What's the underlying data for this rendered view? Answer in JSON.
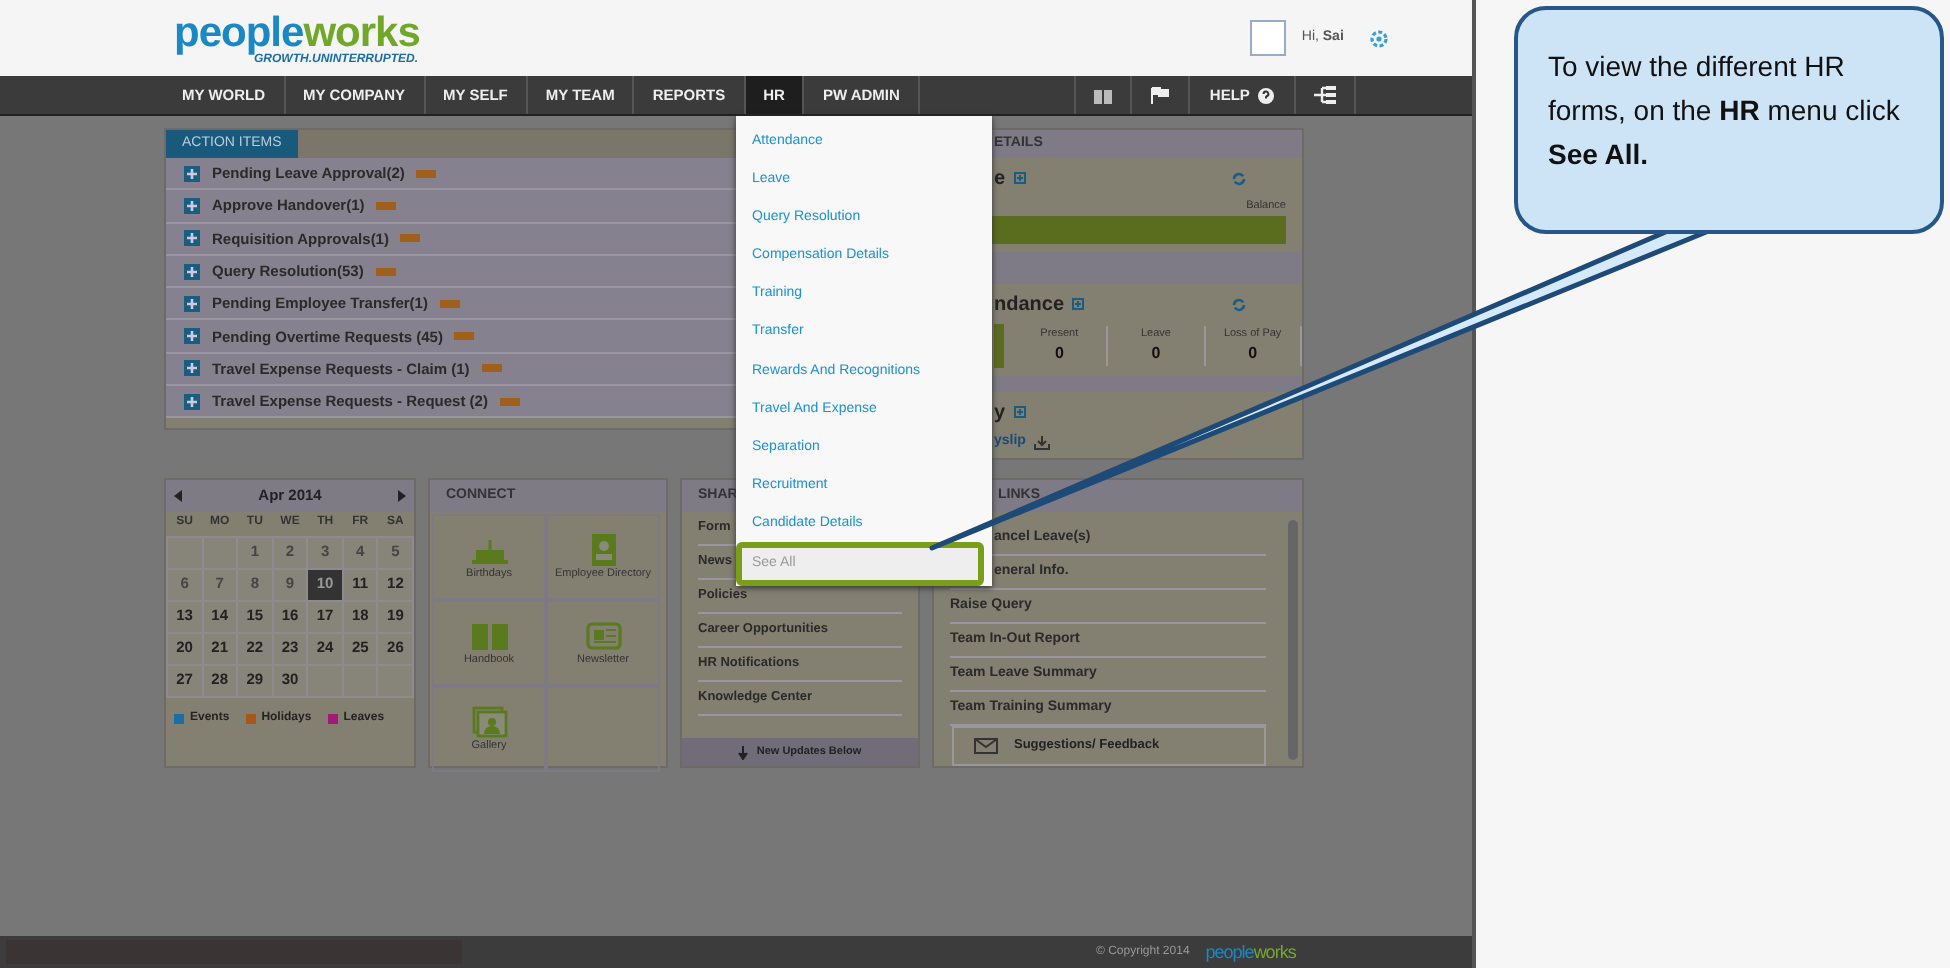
{
  "header": {
    "logo_parts": [
      "people",
      "works"
    ],
    "tagline": "GROWTH.UNINTERRUPTED.",
    "greeting": "Hi,",
    "user": "Sai"
  },
  "nav": [
    {
      "label": "MY WORLD",
      "selected": false
    },
    {
      "label": "MY COMPANY",
      "selected": false
    },
    {
      "label": "MY SELF",
      "selected": false
    },
    {
      "label": "MY TEAM",
      "selected": false
    },
    {
      "label": "REPORTS",
      "selected": false
    },
    {
      "label": "HR",
      "selected": true
    },
    {
      "label": "PW ADMIN",
      "selected": false
    }
  ],
  "help": "HELP",
  "hr_menu": [
    {
      "label": "Attendance",
      "selected": false
    },
    {
      "label": "Leave",
      "selected": false
    },
    {
      "label": "Query Resolution",
      "selected": false
    },
    {
      "label": "Compensation Details",
      "selected": false
    },
    {
      "label": "Training",
      "selected": false
    },
    {
      "label": "Transfer",
      "selected": false
    },
    {
      "label": "Rewards And Recognitions",
      "selected": false
    },
    {
      "label": "Travel And Expense",
      "selected": false
    },
    {
      "label": "Separation",
      "selected": false
    },
    {
      "label": "Recruitment",
      "selected": false
    },
    {
      "label": "Candidate Details",
      "selected": false
    },
    {
      "label": "See All",
      "selected": true
    }
  ],
  "action_items": {
    "title": "ACTION ITEMS",
    "items": [
      "Pending Leave Approval(2)",
      "Approve Handover(1)",
      "Requisition Approvals(1)",
      "Query Resolution(53)",
      "Pending Employee Transfer(1)",
      "Pending Overtime Requests (45)",
      "Travel Expense Requests - Claim (1)",
      "Travel Expense Requests - Request (2)"
    ]
  },
  "details": {
    "title": "ETAILS",
    "leave_title": "e",
    "balance_label": "Balance",
    "attendance_title": "ndance",
    "stats": [
      {
        "label": "Present",
        "value": "0"
      },
      {
        "label": "Leave",
        "value": "0"
      },
      {
        "label": "Loss of Pay",
        "value": "0"
      }
    ],
    "payslip_title": "y",
    "payslip_link": "yslip"
  },
  "calendar": {
    "month": "Apr 2014",
    "weekdays": [
      "SU",
      "MO",
      "TU",
      "WE",
      "TH",
      "FR",
      "SA"
    ],
    "weeks": [
      [
        {
          "kind": "blank"
        },
        {
          "kind": "blank"
        },
        {
          "kind": "day",
          "label": "1",
          "past": true,
          "selected": false
        },
        {
          "kind": "day",
          "label": "2",
          "past": true,
          "selected": false
        },
        {
          "kind": "day",
          "label": "3",
          "past": true,
          "selected": false
        },
        {
          "kind": "day",
          "label": "4",
          "past": true,
          "selected": false
        },
        {
          "kind": "day",
          "label": "5",
          "past": true,
          "selected": false
        }
      ],
      [
        {
          "kind": "day",
          "label": "6",
          "past": true,
          "selected": false
        },
        {
          "kind": "day",
          "label": "7",
          "past": true,
          "selected": false
        },
        {
          "kind": "day",
          "label": "8",
          "past": true,
          "selected": false
        },
        {
          "kind": "day",
          "label": "9",
          "past": true,
          "selected": false
        },
        {
          "kind": "day",
          "label": "10",
          "past": false,
          "selected": true
        },
        {
          "kind": "day",
          "label": "11",
          "past": false,
          "selected": false
        },
        {
          "kind": "day",
          "label": "12",
          "past": false,
          "selected": false
        }
      ],
      [
        {
          "kind": "day",
          "label": "13",
          "past": false,
          "selected": false
        },
        {
          "kind": "day",
          "label": "14",
          "past": false,
          "selected": false
        },
        {
          "kind": "day",
          "label": "15",
          "past": false,
          "selected": false
        },
        {
          "kind": "day",
          "label": "16",
          "past": false,
          "selected": false
        },
        {
          "kind": "day",
          "label": "17",
          "past": false,
          "selected": false
        },
        {
          "kind": "day",
          "label": "18",
          "past": false,
          "selected": false
        },
        {
          "kind": "day",
          "label": "19",
          "past": false,
          "selected": false
        }
      ],
      [
        {
          "kind": "day",
          "label": "20",
          "past": false,
          "selected": false
        },
        {
          "kind": "day",
          "label": "21",
          "past": false,
          "selected": false
        },
        {
          "kind": "day",
          "label": "22",
          "past": false,
          "selected": false
        },
        {
          "kind": "day",
          "label": "23",
          "past": false,
          "selected": false
        },
        {
          "kind": "day",
          "label": "24",
          "past": false,
          "selected": false
        },
        {
          "kind": "day",
          "label": "25",
          "past": false,
          "selected": false
        },
        {
          "kind": "day",
          "label": "26",
          "past": false,
          "selected": false
        }
      ],
      [
        {
          "kind": "day",
          "label": "27",
          "past": false,
          "selected": false
        },
        {
          "kind": "day",
          "label": "28",
          "past": false,
          "selected": false
        },
        {
          "kind": "day",
          "label": "29",
          "past": false,
          "selected": false
        },
        {
          "kind": "day",
          "label": "30",
          "past": false,
          "selected": false
        },
        {
          "kind": "blank"
        },
        {
          "kind": "blank"
        },
        {
          "kind": "blank"
        }
      ]
    ],
    "legend": [
      {
        "label": "Events",
        "color": "#1a6ea8"
      },
      {
        "label": "Holidays",
        "color": "#a8561a"
      },
      {
        "label": "Leaves",
        "color": "#a01a78"
      }
    ]
  },
  "connect": {
    "title": "CONNECT",
    "tiles": [
      {
        "label": "Birthdays",
        "kind": "cake"
      },
      {
        "label": "Employee Directory",
        "kind": "directory"
      },
      {
        "label": "Handbook",
        "kind": "book"
      },
      {
        "label": "Newsletter",
        "kind": "news"
      },
      {
        "label": "Gallery",
        "kind": "gallery"
      }
    ]
  },
  "shared": {
    "title": "SHAR",
    "links": [
      "Form",
      "News",
      "Policies",
      "Career Opportunities",
      "HR Notifications",
      "Knowledge Center"
    ],
    "footer": "New Updates Below"
  },
  "quick_links": {
    "title": "LINKS",
    "links": [
      "ancel Leave(s)",
      "eneral Info.",
      "Raise Query",
      "Team In-Out Report",
      "Team Leave Summary",
      "Team Training Summary"
    ],
    "feedback": "Suggestions/ Feedback"
  },
  "footer": {
    "copyright": "© Copyright 2014",
    "logo_parts": [
      "people",
      "works"
    ]
  },
  "callout": {
    "text": "To view the different HR forms, on the  **HR** menu click **See All.**"
  }
}
